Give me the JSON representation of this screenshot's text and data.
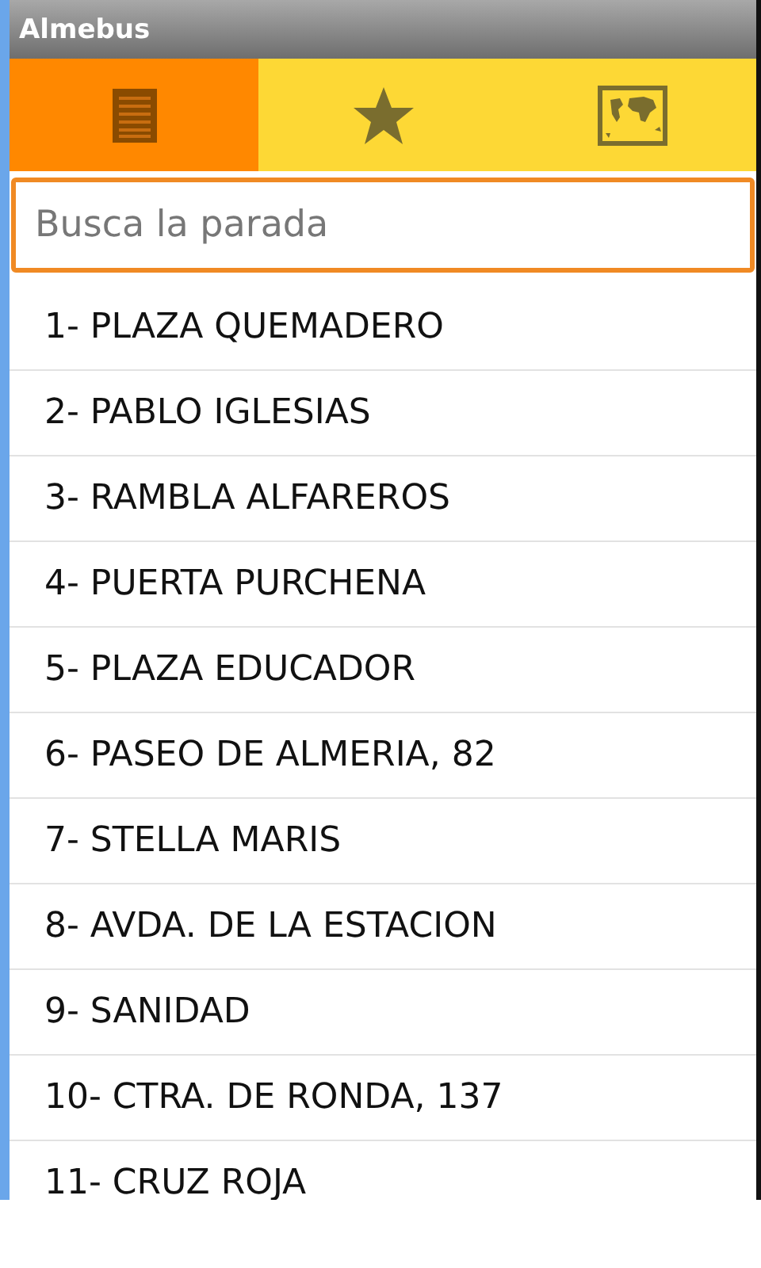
{
  "window": {
    "title": "Almebus"
  },
  "tabs": [
    {
      "kind": "list",
      "selected": true
    },
    {
      "kind": "star",
      "selected": false
    },
    {
      "kind": "map",
      "selected": false
    }
  ],
  "search": {
    "placeholder": "Busca la parada"
  },
  "stops": [
    "1- PLAZA QUEMADERO",
    "2- PABLO IGLESIAS",
    "3- RAMBLA ALFAREROS",
    "4- PUERTA PURCHENA",
    "5- PLAZA EDUCADOR",
    "6- PASEO DE ALMERIA, 82",
    "7- STELLA MARIS",
    "8- AVDA. DE LA ESTACION",
    "9- SANIDAD",
    "10- CTRA. DE RONDA, 137",
    "11- CRUZ ROJA"
  ]
}
